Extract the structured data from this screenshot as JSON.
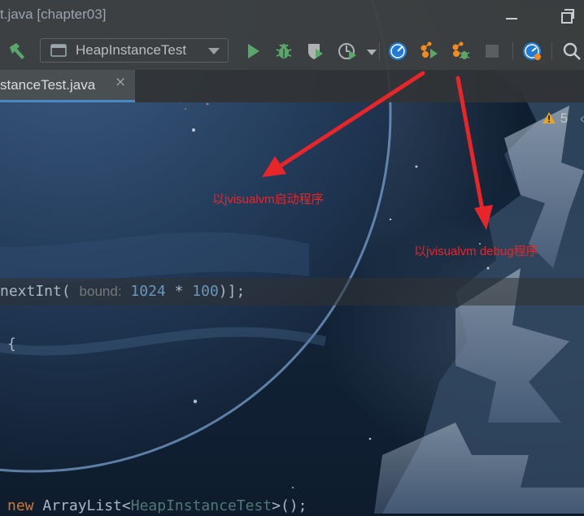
{
  "window": {
    "title": "t.java [chapter03]"
  },
  "toolbar": {
    "run_config": "HeapInstanceTest",
    "icons": [
      "hammer-build-icon",
      "run-config-icon",
      "run-icon",
      "debug-icon",
      "coverage-icon",
      "profile-icon",
      "visualvm-icon",
      "visualvm-run-icon",
      "visualvm-debug-icon",
      "stop-icon",
      "profiler-dashboard-icon",
      "search-icon"
    ]
  },
  "editor": {
    "tab": {
      "label": "stanceTest.java",
      "close": "×"
    },
    "inspections": {
      "count": "5"
    },
    "code": {
      "line1": {
        "name": "nextInt(",
        "hint": "bound:",
        "num1": "1024",
        "op": " * ",
        "num2": "100",
        "tail": ")];"
      },
      "line2": {
        "text": "{"
      },
      "line3": {
        "kw": "new",
        "type": " ArrayList<",
        "gen": "HeapInstanceTest",
        "tail": ">();"
      }
    }
  },
  "annotations": {
    "label_run": "以jvisualvm启动程序",
    "label_debug": "以jvisualvm debug程序",
    "color": "#e8262a"
  }
}
